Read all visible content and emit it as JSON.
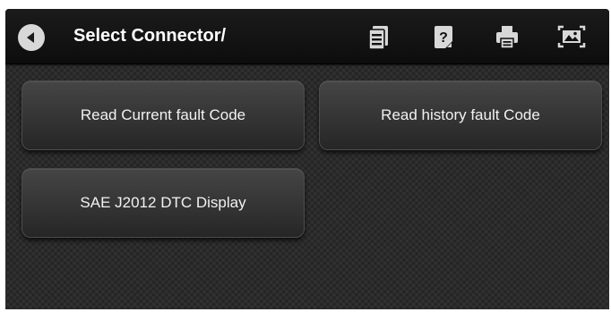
{
  "header": {
    "title": "Select Connector/"
  },
  "toolbar": {
    "icons": [
      "back-icon",
      "report-icon",
      "help-icon",
      "print-icon",
      "screenshot-icon"
    ]
  },
  "menu": {
    "read_current": "Read Current fault Code",
    "read_history": "Read history fault Code",
    "sae_display": "SAE J2012 DTC Display"
  },
  "colors": {
    "header_bg": "#111111",
    "screen_bg": "#2b2b2b",
    "button_bg": "#363636",
    "icon": "#d8d8d8"
  }
}
